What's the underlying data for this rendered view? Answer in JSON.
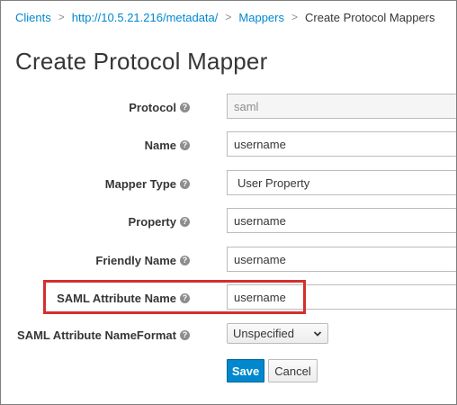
{
  "breadcrumb": {
    "items": [
      "Clients",
      "http://10.5.21.216/metadata/",
      "Mappers"
    ],
    "current": "Create Protocol Mappers"
  },
  "page_title": "Create Protocol Mapper",
  "form": {
    "protocol": {
      "label": "Protocol",
      "value": "saml"
    },
    "name": {
      "label": "Name",
      "value": "username"
    },
    "mapper_type": {
      "label": "Mapper Type",
      "value": "User Property"
    },
    "property": {
      "label": "Property",
      "value": "username"
    },
    "friendly_name": {
      "label": "Friendly Name",
      "value": "username"
    },
    "saml_attribute_name": {
      "label": "SAML Attribute Name",
      "value": "username"
    },
    "saml_attribute_nameformat": {
      "label": "SAML Attribute NameFormat",
      "value": "Unspecified"
    }
  },
  "buttons": {
    "save": "Save",
    "cancel": "Cancel"
  },
  "icons": {
    "help": "question-circle-icon",
    "dropdown": "chevron-down-icon"
  },
  "colors": {
    "link": "#0088ce",
    "primary": "#0088ce",
    "highlight": "#d32f2f"
  }
}
